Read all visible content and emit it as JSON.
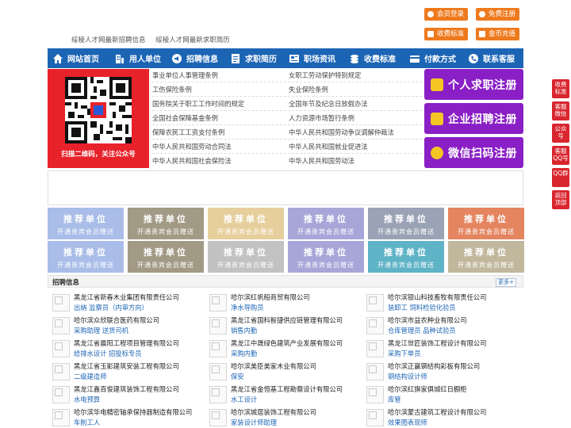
{
  "top_buttons": {
    "member_login": "会员登录",
    "free_register": "免费注册",
    "fee_standard": "收费标准",
    "gold_recharge": "金币充值"
  },
  "top_links": [
    "绥棱人才网最新招聘信息",
    "绥棱人才网最新求职简历"
  ],
  "nav": [
    {
      "label": "网站首页",
      "icon": "home-icon"
    },
    {
      "label": "用人单位",
      "icon": "building-icon"
    },
    {
      "label": "招聘信息",
      "icon": "megaphone-icon"
    },
    {
      "label": "求职简历",
      "icon": "resume-icon"
    },
    {
      "label": "职场资讯",
      "icon": "news-icon"
    },
    {
      "label": "收费标准",
      "icon": "coins-icon"
    },
    {
      "label": "付款方式",
      "icon": "card-icon"
    },
    {
      "label": "联系客服",
      "icon": "phone-icon"
    }
  ],
  "qr_caption": "扫描二维码，关注公众号",
  "policy_links": {
    "left": [
      "事业单位人事管理条例",
      "工伤保险条例",
      "国务院关于职工工作时间的规定",
      "全国社会保障基金条例",
      "保障农民工工资支付条例",
      "中华人民共和国劳动合同法",
      "中华人民共和国社会保险法"
    ],
    "right": [
      "女职工劳动保护特别规定",
      "失业保险条例",
      "全国年节及纪念日放假办法",
      "人力资源市场暂行条例",
      "中华人民共和国劳动争议调解仲裁法",
      "中华人民共和国就业促进法",
      "中华人民共和国劳动法"
    ]
  },
  "register_buttons": [
    "个人求职注册",
    "企业招聘注册",
    "微信扫码注册"
  ],
  "recommend": {
    "title": "推荐单位",
    "subtitle": "开通贵宾会员赠送",
    "colors": [
      "#a9bde8",
      "#a39a86",
      "#e6cf9c",
      "#a8a6d8",
      "#9aa3b6",
      "#e48560",
      "#a9bde8",
      "#a39a86",
      "#c2c2c2",
      "#a8a6d8",
      "#5eb3c6",
      "#c0b79c"
    ]
  },
  "jobs": {
    "title": "招聘信息",
    "more": "更多+",
    "items": [
      {
        "company": "黑龙江省新春木业集团有限责任公司",
        "positions": "出纳 监察员（内审方向）"
      },
      {
        "company": "哈尔滨红帆船商贸有限公司",
        "positions": "净水导购员"
      },
      {
        "company": "哈尔滨银山科技畜牧有限责任公司",
        "positions": "装卸工 饲料检验化验员"
      },
      {
        "company": "哈尔滨众欣联合医药有限公司",
        "positions": "采购助理 送货司机"
      },
      {
        "company": "黑龙江省国科智捷供应链管理有限公司",
        "positions": "销售内勤"
      },
      {
        "company": "哈尔滨市益农种业有限公司",
        "positions": "仓库管理员 品种试验员"
      },
      {
        "company": "黑龙江省晨阳工程项目管理有限公司",
        "positions": "给排水设计 招投标专员"
      },
      {
        "company": "黑龙江中晟绿色建筑产业发展有限公司",
        "positions": "采购内勤"
      },
      {
        "company": "黑龙江世匠装饰工程设计有限公司",
        "positions": "采购下单员"
      },
      {
        "company": "黑龙江省玉影建筑安装工程有限公司",
        "positions": "二级建造师"
      },
      {
        "company": "哈尔滨美臣美家木业有限公司",
        "positions": "保安"
      },
      {
        "company": "哈尔滨正赢钢结构彩板有限公司",
        "positions": "钢结构设计师"
      },
      {
        "company": "黑龙江鑫百俊建筑装饰工程有限公司",
        "positions": "水电预算"
      },
      {
        "company": "黑龙江省金恒基工程勘察设计有限公司",
        "positions": "水工设计"
      },
      {
        "company": "哈尔滨红旗家俱城红日橱柜",
        "positions": "库管"
      },
      {
        "company": "哈尔滨华电精密轴承保持器制造有限公司",
        "positions": "车削工人"
      },
      {
        "company": "哈尔滨城居装饰工程有限公司",
        "positions": "家装设计师助理"
      },
      {
        "company": "哈尔滨蒙古建筑工程设计有限公司",
        "positions": "效果图表现师"
      }
    ]
  },
  "float_bar": [
    {
      "label": "收费标准",
      "name": "float-fee-standard"
    },
    {
      "label": "客服微信",
      "name": "float-service-wechat"
    },
    {
      "label": "公众号",
      "name": "float-official-account"
    },
    {
      "label": "客服QQ号",
      "name": "float-service-qq"
    },
    {
      "label": "QQ群",
      "name": "float-qq-group"
    },
    {
      "label": "返回顶部",
      "name": "float-back-to-top"
    }
  ]
}
